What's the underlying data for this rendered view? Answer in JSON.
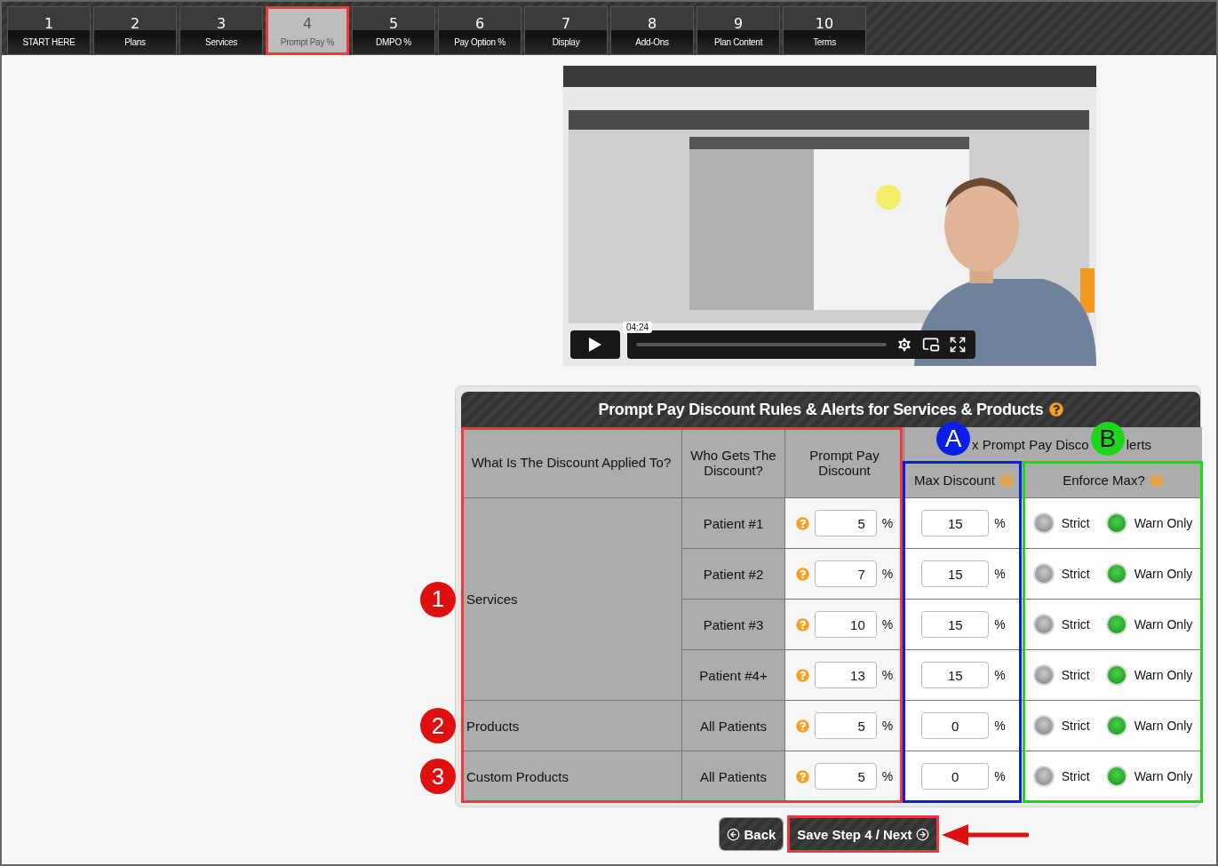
{
  "tabs": [
    {
      "number": "1",
      "label": "START HERE",
      "selected": false
    },
    {
      "number": "2",
      "label": "Plans",
      "selected": false
    },
    {
      "number": "3",
      "label": "Services",
      "selected": false
    },
    {
      "number": "4",
      "label": "Prompt Pay %",
      "selected": true
    },
    {
      "number": "5",
      "label": "DMPO %",
      "selected": false
    },
    {
      "number": "6",
      "label": "Pay Option %",
      "selected": false
    },
    {
      "number": "7",
      "label": "Display",
      "selected": false
    },
    {
      "number": "8",
      "label": "Add-Ons",
      "selected": false
    },
    {
      "number": "9",
      "label": "Plan Content",
      "selected": false
    },
    {
      "number": "10",
      "label": "Terms",
      "selected": false
    }
  ],
  "video": {
    "kind": "picture",
    "time": "04:24"
  },
  "panel": {
    "title": "Prompt Pay Discount Rules & Alerts for Services & Products",
    "columns": [
      "What Is The Discount Applied To?",
      "Who Gets The Discount?",
      "Prompt Pay Discount"
    ],
    "alerts_header": [
      {
        "marker": "A",
        "text": "x Prompt Pay Disco"
      },
      {
        "marker": "B",
        "text": "lerts"
      }
    ],
    "max_header": "Max Discount",
    "enforce_header": "Enforce Max?",
    "groups": [
      {
        "name": "Services",
        "marker": "1",
        "rows": [
          {
            "who": "Patient #1",
            "discount": "5",
            "unit": "%",
            "max": "15",
            "max_unit": "%",
            "enforce": [
              {
                "label": "Strict",
                "selected": false
              },
              {
                "label": "Warn Only",
                "selected": true
              }
            ]
          },
          {
            "who": "Patient #2",
            "discount": "7",
            "unit": "%",
            "max": "15",
            "max_unit": "%",
            "enforce": [
              {
                "label": "Strict",
                "selected": false
              },
              {
                "label": "Warn Only",
                "selected": true
              }
            ]
          },
          {
            "who": "Patient #3",
            "discount": "10",
            "unit": "%",
            "max": "15",
            "max_unit": "%",
            "enforce": [
              {
                "label": "Strict",
                "selected": false
              },
              {
                "label": "Warn Only",
                "selected": true
              }
            ]
          },
          {
            "who": "Patient #4+",
            "discount": "13",
            "unit": "%",
            "max": "15",
            "max_unit": "%",
            "enforce": [
              {
                "label": "Strict",
                "selected": false
              },
              {
                "label": "Warn Only",
                "selected": true
              }
            ]
          }
        ]
      },
      {
        "name": "Products",
        "marker": "2",
        "rows": [
          {
            "who": "All Patients",
            "discount": "5",
            "unit": "%",
            "max": "0",
            "max_unit": "%",
            "enforce": [
              {
                "label": "Strict",
                "selected": false
              },
              {
                "label": "Warn Only",
                "selected": true
              }
            ]
          }
        ]
      },
      {
        "name": "Custom Products",
        "marker": "3",
        "rows": [
          {
            "who": "All Patients",
            "discount": "5",
            "unit": "%",
            "max": "0",
            "max_unit": "%",
            "enforce": [
              {
                "label": "Strict",
                "selected": false
              },
              {
                "label": "Warn Only",
                "selected": true
              }
            ]
          }
        ]
      }
    ]
  },
  "buttons": {
    "back": "Back",
    "next": "Save Step 4 / Next"
  }
}
